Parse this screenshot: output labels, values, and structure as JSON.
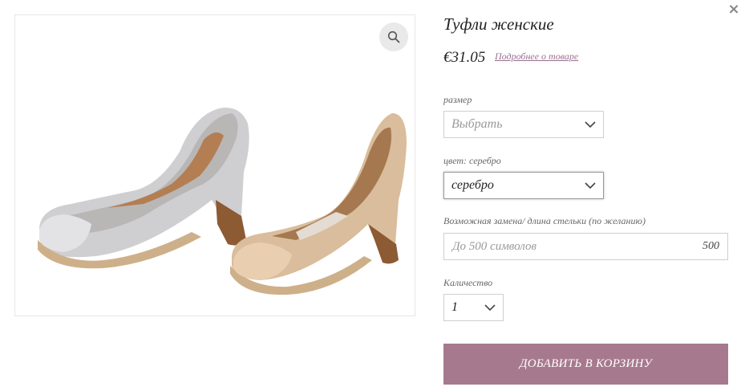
{
  "product": {
    "title": "Туфли женские",
    "price": "€31.05",
    "details_link": "Подробнее о товаре",
    "image_alt": "Туфли женские"
  },
  "size": {
    "label": "размер",
    "placeholder": "Выбрать"
  },
  "color": {
    "label": "цвет: серебро",
    "selected": "серебро"
  },
  "insole": {
    "label": "Возможная замена/ длина стельки (по желанию)",
    "placeholder": "До 500 символов",
    "counter": "500"
  },
  "quantity": {
    "label": "Каличество",
    "selected": "1"
  },
  "actions": {
    "add_to_cart": "ДОБАВИТЬ В КОРЗИНУ",
    "close": "×"
  },
  "colors": {
    "accent": "#a7798e",
    "link": "#9a7090"
  },
  "icons": {
    "close": "close-icon",
    "zoom": "magnifier-icon",
    "dropdown": "chevron-down-icon"
  }
}
